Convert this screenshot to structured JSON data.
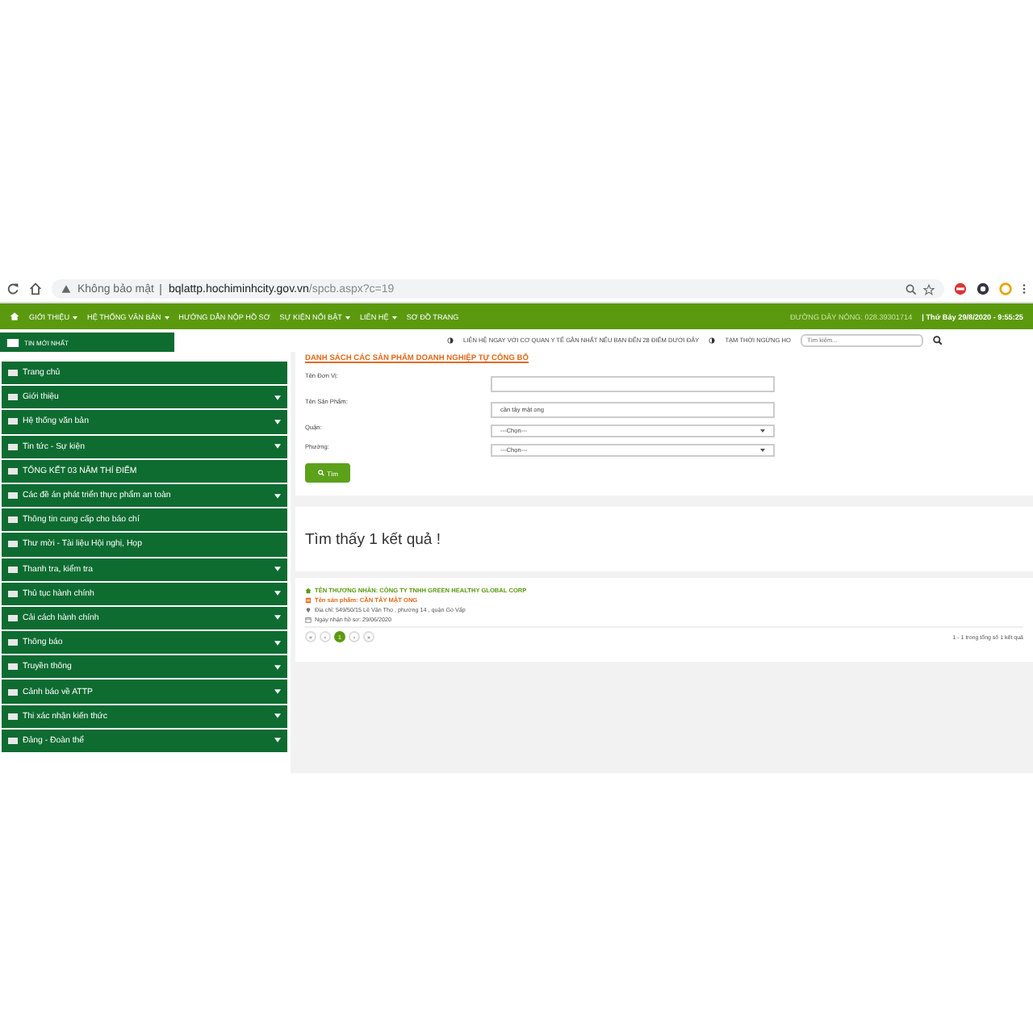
{
  "browser": {
    "security": "Không bảo mật",
    "url_host": "bqlattp.hochiminhcity.gov.vn",
    "url_path": "/spcb.aspx?c=19"
  },
  "nav": {
    "items": [
      {
        "label": "GIỚI THIỆU",
        "has_submenu": true
      },
      {
        "label": "HỆ THỐNG VĂN BẢN",
        "has_submenu": true
      },
      {
        "label": "HƯỚNG DẪN NỘP HỒ SƠ",
        "has_submenu": false
      },
      {
        "label": "SỰ KIỆN NỔI BẬT",
        "has_submenu": true
      },
      {
        "label": "LIÊN HỆ",
        "has_submenu": true
      },
      {
        "label": "SƠ ĐỒ TRANG",
        "has_submenu": false
      }
    ],
    "hotline": "ĐƯỜNG DÂY NÓNG: 028.39301714",
    "datetime": "| Thứ Bảy 29/8/2020 - 9:55:25"
  },
  "news_tab": "TIN MỚI NHẤT",
  "ticker": [
    "LIÊN HỆ NGAY VỚI CƠ QUAN Y TẾ GẦN NHẤT NẾU BẠN ĐẾN 28 ĐIỂM DƯỚI ĐÂY",
    "TẠM THỜI NGỪNG HO"
  ],
  "search": {
    "placeholder": "Tìm kiếm..."
  },
  "sidebar": {
    "items": [
      {
        "label": "Trang chủ",
        "has_submenu": false
      },
      {
        "label": "Giới thiệu",
        "has_submenu": true
      },
      {
        "label": "Hệ thống văn bản",
        "has_submenu": true
      },
      {
        "label": "Tin tức - Sự kiện",
        "has_submenu": true
      },
      {
        "label": "TỔNG KẾT 03 NĂM THÍ ĐIỂM",
        "has_submenu": false
      },
      {
        "label": "Các đề án phát triển thực phẩm an toàn",
        "has_submenu": true
      },
      {
        "label": "Thông tin cung cấp cho báo chí",
        "has_submenu": false
      },
      {
        "label": "Thư mời - Tài liệu Hội nghị, Họp",
        "has_submenu": false
      },
      {
        "label": "Thanh tra, kiểm tra",
        "has_submenu": true
      },
      {
        "label": "Thủ tục hành chính",
        "has_submenu": true
      },
      {
        "label": "Cải cách hành chính",
        "has_submenu": true
      },
      {
        "label": "Thông báo",
        "has_submenu": true
      },
      {
        "label": "Truyền thông",
        "has_submenu": true
      },
      {
        "label": "Cảnh báo về ATTP",
        "has_submenu": true
      },
      {
        "label": "Thi xác nhận kiến thức",
        "has_submenu": true
      },
      {
        "label": "Đảng - Đoàn thể",
        "has_submenu": true
      }
    ]
  },
  "form": {
    "title": "DANH SÁCH CÁC SẢN PHẨM DOANH NGHIỆP TỰ CÔNG BỐ",
    "fields": [
      {
        "label": "Tên Đơn Vị:",
        "kind": "text"
      },
      {
        "label": "Tên Sản Phẩm:",
        "kind": "text",
        "value": "cần tây mật ong"
      },
      {
        "label": "Quận:",
        "kind": "select",
        "value": "---Chọn---"
      },
      {
        "label": "Phường:",
        "kind": "select",
        "value": "---Chọn---"
      }
    ],
    "button": "Tìm"
  },
  "results": {
    "heading": "Tìm thấy 1 kết quả !",
    "items": [
      {
        "merchant": "TÊN THƯƠNG NHÂN: CÔNG TY TNHH GREEN HEALTHY GLOBAL CORP",
        "product": "Tên sản phẩm: CẦN TÂY MẬT ONG",
        "address": "Địa chỉ: 549/50/15 Lê Văn Thọ , phường 14 , quận Gò Vấp",
        "date": "Ngày nhận hồ sơ: 29/06/2020"
      }
    ],
    "pager": [
      {
        "label": "«",
        "selected": false
      },
      {
        "label": "‹",
        "selected": false
      },
      {
        "label": "1",
        "selected": true
      },
      {
        "label": "›",
        "selected": false
      },
      {
        "label": "»",
        "selected": false
      }
    ],
    "summary": "1 - 1 trong tổng số 1 kết quả"
  }
}
